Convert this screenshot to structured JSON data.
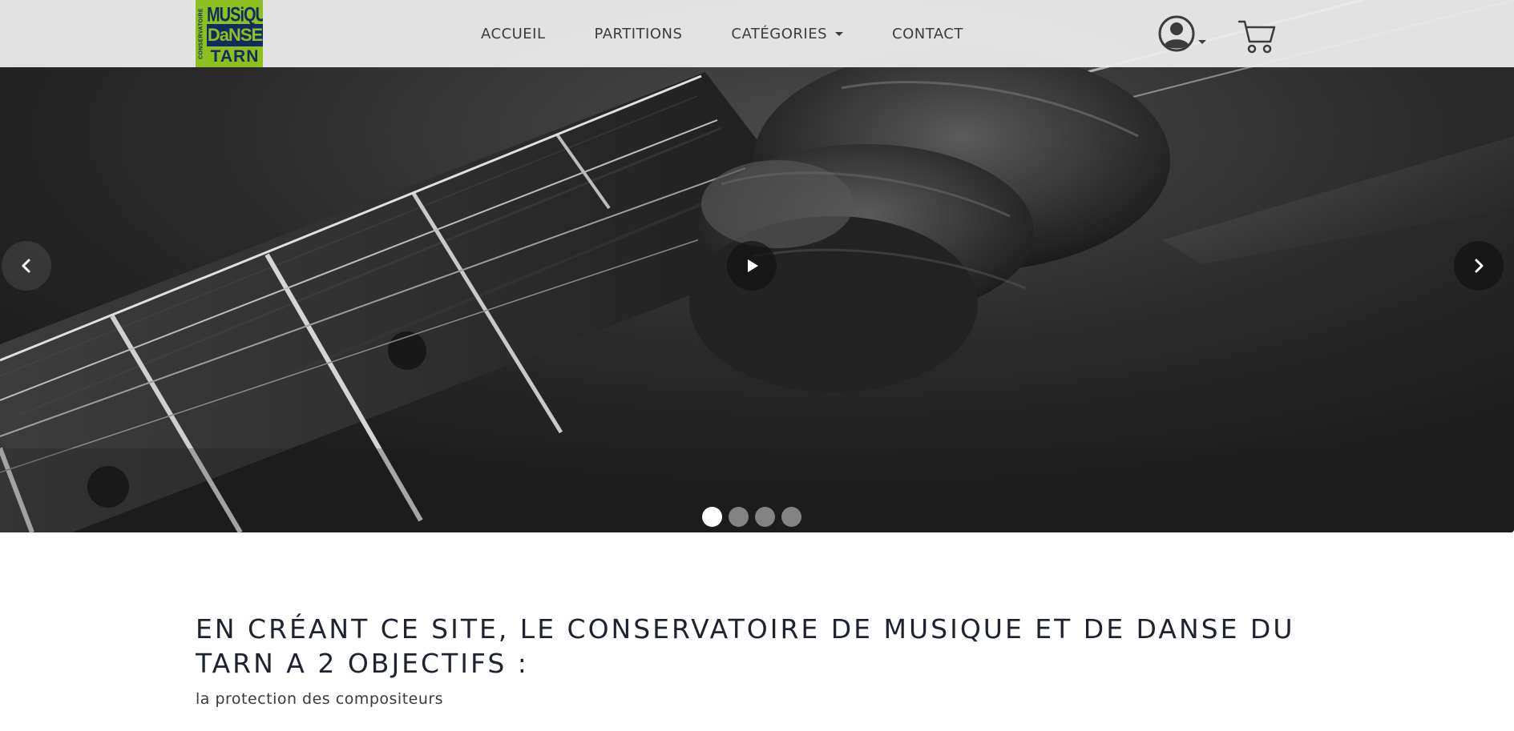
{
  "logo": {
    "side_text": "CONSERVATOIRE",
    "line1": "MUSiQUE",
    "line2": "DaNSE",
    "line3": "TARN",
    "colors": {
      "green": "#8fbf1f",
      "navy": "#0f2d63"
    }
  },
  "nav": {
    "items": [
      {
        "label": "ACCUEIL"
      },
      {
        "label": "PARTITIONS"
      },
      {
        "label": "CATÉGORIES",
        "has_dropdown": true
      },
      {
        "label": "CONTACT"
      }
    ],
    "user_icon": "user-circle-icon",
    "cart_icon": "cart-icon"
  },
  "carousel": {
    "slide_count": 4,
    "active_slide": 1,
    "controls": [
      "chevron-left-icon",
      "play-icon",
      "chevron-right-icon"
    ]
  },
  "content": {
    "headline": "EN CRÉANT CE SITE, LE CONSERVATOIRE DE MUSIQUE ET DE DANSE DU TARN A 2 OBJECTIFS :",
    "subline": "la protection des compositeurs"
  }
}
